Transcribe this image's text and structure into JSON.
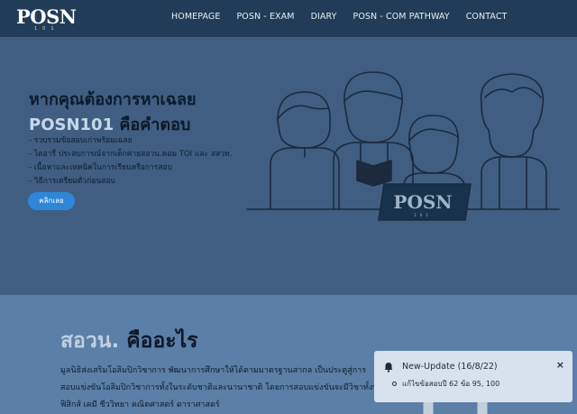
{
  "navbar": {
    "logo_text": "POSN",
    "logo_sub": "101",
    "items": [
      {
        "label": "HOMEPAGE"
      },
      {
        "label": "POSN - EXAM"
      },
      {
        "label": "DIARY"
      },
      {
        "label": "POSN - COM PATHWAY"
      },
      {
        "label": "CONTACT"
      }
    ]
  },
  "hero": {
    "title_line1": "หากคุณต้องการหาเฉลย",
    "title_accent": "POSN101",
    "title_rest": " คือคำตอบ",
    "bullets": [
      "- รวบรวมข้อสอบเก่าพร้อมเฉลย",
      "- ไดอารี่ ประสบการณ์จากเด็กค่ายสอวน.คอม TOI และ สสวท.",
      "- เนื้อหาและเทคนิคในการเรียนหรือการสอบ",
      "- วิธีการเตรียมตัวก่อนสอบ"
    ],
    "button_label": "คลิกเลย",
    "laptop_text": "POSN",
    "laptop_sub": "101"
  },
  "section2": {
    "title_light": "สอวน.",
    "title_dark": " คืออะไร",
    "lines": [
      "มูลนิธิส่งเสริมโอลิมปิกวิชาการ พัฒนาการศึกษาให้ได้ตามมาตรฐานสากล เป็นประตูสู่การ",
      "สอบแข่งขันโอลิมปิกวิชาการทั้งในระดับชาติและนานาชาติ โดยการสอบแข่งขันจะมีวิชาทั้งหมด",
      "ฟิสิกส์ เคมี ชีววิทยา คณิตศาสตร์ ดาราศาสตร์"
    ]
  },
  "toast": {
    "title": "New-Update (16/8/22)",
    "close": "×",
    "item": "แก้ไขข้อสอบปี 62 ข้อ 95, 100"
  },
  "colors": {
    "navbar_bg": "#213c58",
    "hero_bg": "#3f5e82",
    "section2_bg": "#5b7fa6",
    "button": "#2f86d8",
    "toast_bg": "#d7e2ee"
  }
}
